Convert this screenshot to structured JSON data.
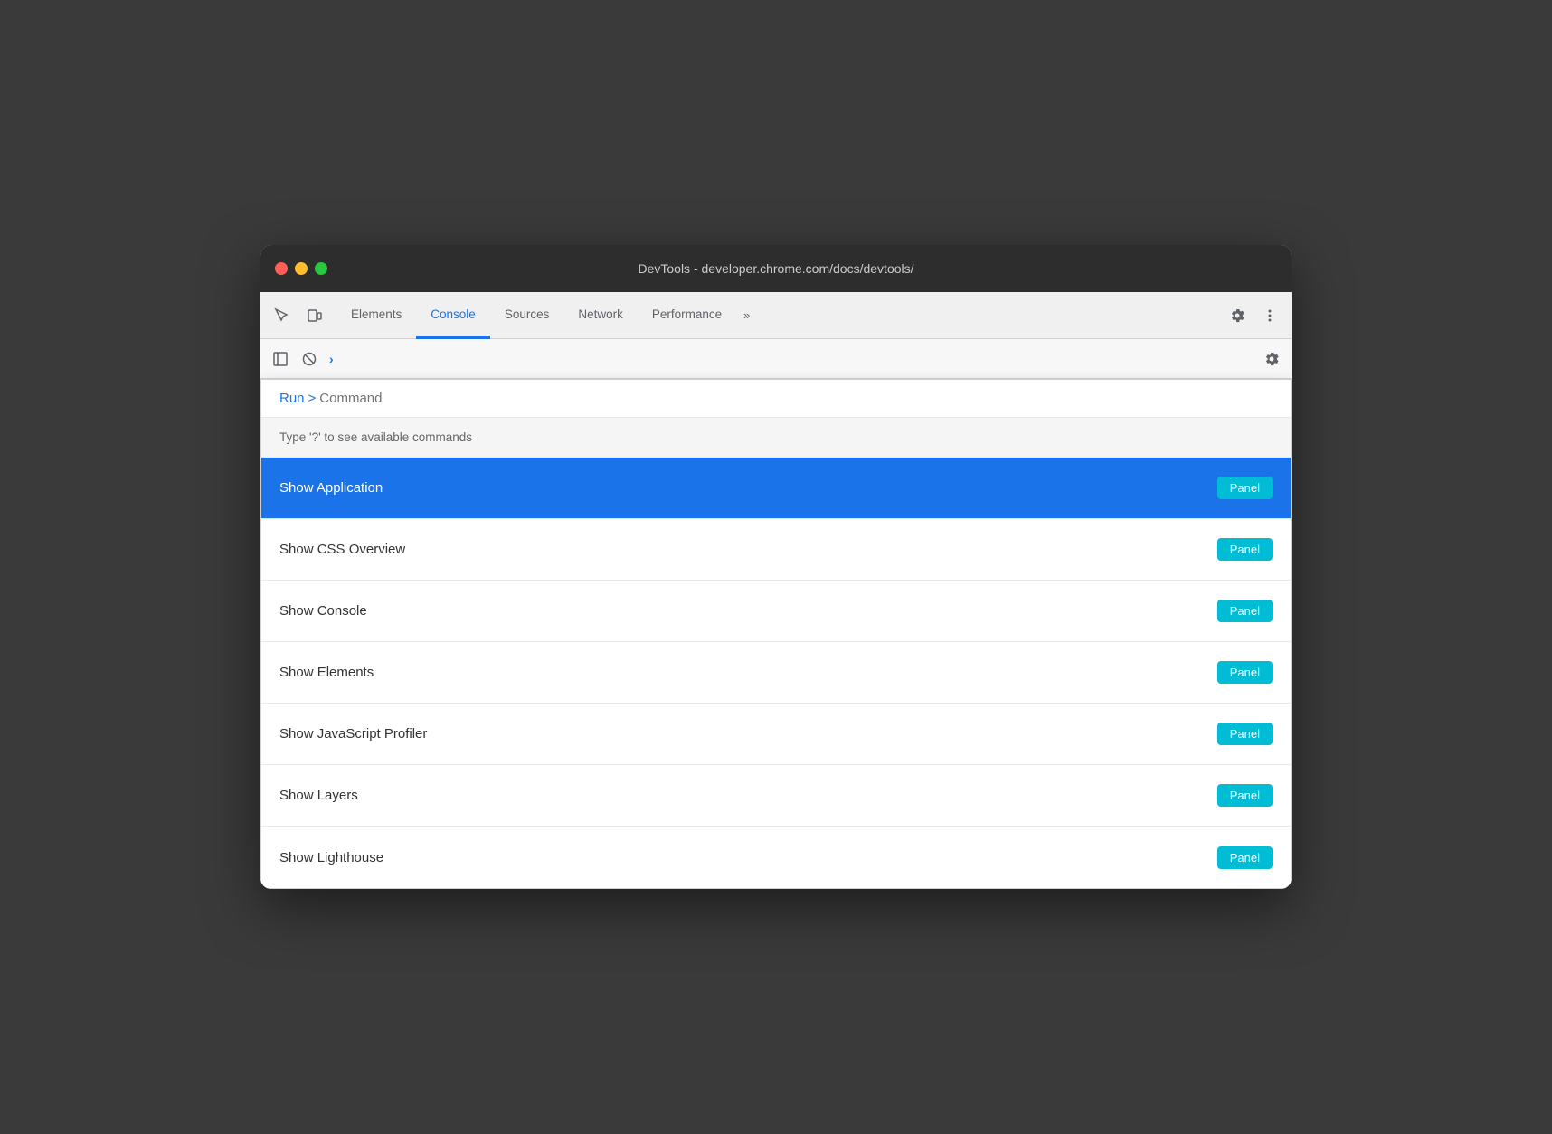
{
  "window": {
    "title": "DevTools - developer.chrome.com/docs/devtools/"
  },
  "traffic_lights": {
    "close": "close",
    "minimize": "minimize",
    "maximize": "maximize"
  },
  "toolbar": {
    "tabs": [
      {
        "id": "elements",
        "label": "Elements",
        "active": false
      },
      {
        "id": "console",
        "label": "Console",
        "active": true
      },
      {
        "id": "sources",
        "label": "Sources",
        "active": false
      },
      {
        "id": "network",
        "label": "Network",
        "active": false
      },
      {
        "id": "performance",
        "label": "Performance",
        "active": false
      }
    ],
    "more_tabs_label": "»"
  },
  "command_menu": {
    "run_label": "Run",
    "prompt_symbol": ">",
    "input_placeholder": "Command",
    "hint_text": "Type '?' to see available commands",
    "items": [
      {
        "id": "show-application",
        "label": "Show Application",
        "badge": "Panel",
        "selected": true
      },
      {
        "id": "show-css-overview",
        "label": "Show CSS Overview",
        "badge": "Panel",
        "selected": false
      },
      {
        "id": "show-console",
        "label": "Show Console",
        "badge": "Panel",
        "selected": false
      },
      {
        "id": "show-elements",
        "label": "Show Elements",
        "badge": "Panel",
        "selected": false
      },
      {
        "id": "show-javascript-profiler",
        "label": "Show JavaScript Profiler",
        "badge": "Panel",
        "selected": false
      },
      {
        "id": "show-layers",
        "label": "Show Layers",
        "badge": "Panel",
        "selected": false
      },
      {
        "id": "show-lighthouse",
        "label": "Show Lighthouse",
        "badge": "Panel",
        "selected": false
      }
    ]
  },
  "colors": {
    "accent_blue": "#1a73e8",
    "accent_teal": "#00bcd4",
    "selected_bg": "#1a73e8",
    "toolbar_bg": "#f0f0f0"
  }
}
